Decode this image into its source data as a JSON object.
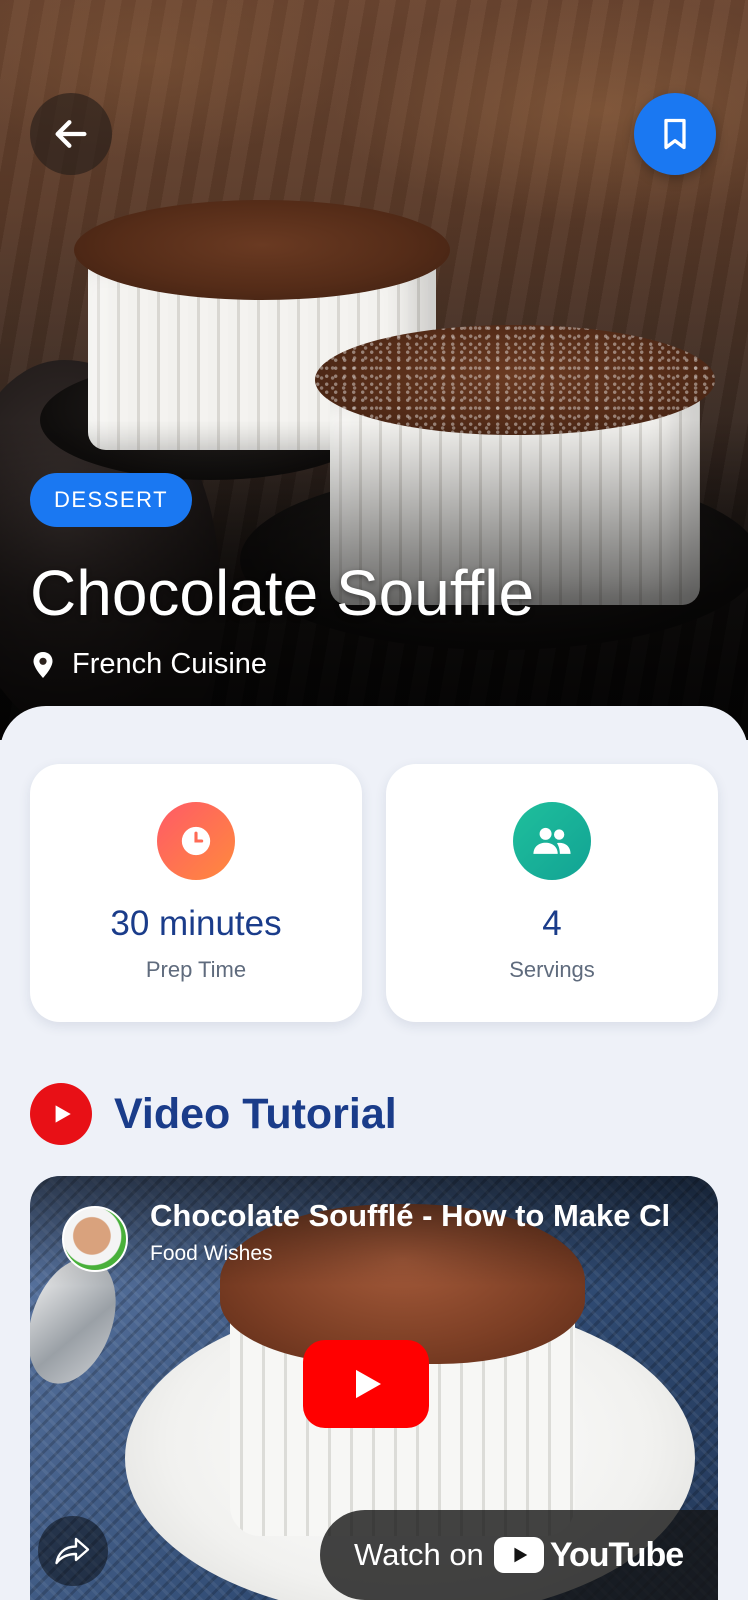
{
  "hero": {
    "category": "DESSERT",
    "title": "Chocolate Souffle",
    "cuisine": "French Cuisine"
  },
  "icons": {
    "back": "arrow-left-icon",
    "bookmark": "bookmark-icon",
    "location": "location-pin-icon",
    "clock": "clock-icon",
    "people": "people-icon",
    "youtube": "play-icon",
    "share": "share-icon"
  },
  "stats": {
    "prep": {
      "value": "30 minutes",
      "label": "Prep Time"
    },
    "servings": {
      "value": "4",
      "label": "Servings"
    }
  },
  "video_section": {
    "title": "Video Tutorial",
    "video_title": "Chocolate Soufflé - How to Make Cl",
    "channel": "Food Wishes",
    "watch_on": "Watch on",
    "brand": "YouTube"
  },
  "colors": {
    "accent": "#1a78f2",
    "heading": "#1a3c8a",
    "youtube_red": "#ff0000"
  }
}
